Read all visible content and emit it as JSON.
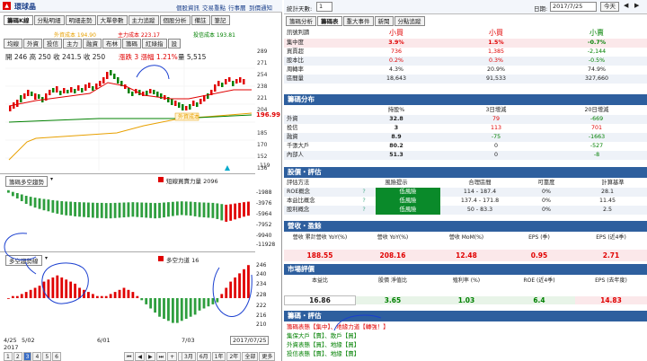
{
  "left": {
    "stock_name": "環球晶",
    "links": [
      "個股資訊",
      "交易重點",
      "行事曆",
      "到價通知"
    ],
    "top_tabs": [
      "籌碼K線",
      "分點明細",
      "明細走勢",
      "大單參數",
      "主力追蹤",
      "個股分析",
      "備註",
      "筆記"
    ],
    "sub_tabs": [
      "均線",
      "外資",
      "投信",
      "主力",
      "融資",
      "布林",
      "籌碼",
      "紅綠指",
      "設"
    ],
    "ma_legend": [
      {
        "label": "外資成本 194.90",
        "color": "#e8a000"
      },
      {
        "label": "主力成本 223.17",
        "color": "#e00000"
      },
      {
        "label": "投信成本 193.81",
        "color": "#008000"
      }
    ],
    "ohlc": "開 246  高 250  收 241.5  收 250",
    "change": "漲跌 3   漲幅 1.21%",
    "volume": "量 5,515",
    "price_axis": [
      "289",
      "271",
      "254",
      "238",
      "221",
      "204",
      "185",
      "170",
      "152",
      "136",
      "119"
    ],
    "last_price": "196.99",
    "indicator1_label": "籌碼多空趨勢",
    "indicator1_value": "短線買賣力量 2096",
    "indicator1_axis": [
      "-1988",
      "-3976",
      "-5964",
      "-7952",
      "-9940",
      "-11928"
    ],
    "indicator2_label": "多空趨勢線",
    "indicator2_value": "多空力道 16",
    "indicator2_axis": [
      "246",
      "240",
      "234",
      "228",
      "222",
      "216",
      "210"
    ],
    "x_axis": [
      "4/25",
      "5/02",
      "6/01",
      "7/03"
    ],
    "year": "2017",
    "cursor_date": "2017/07/25",
    "pages": [
      "1",
      "2",
      "3",
      "4",
      "5",
      "6"
    ],
    "periods": [
      "3月",
      "6月",
      "1年",
      "2年",
      "全部",
      "更多"
    ]
  },
  "right": {
    "stat_label": "統計天數:",
    "stat_value": "1",
    "date_label": "日期:",
    "date_value": "2017/7/25",
    "today_btn": "今天",
    "tabs": [
      "籌碼分析",
      "籌碼表",
      "重大事件",
      "新聞",
      "分點追蹤"
    ],
    "summary": {
      "headers": [
        "訊號判讀",
        "小買",
        "小買",
        "小賣"
      ],
      "rows": [
        {
          "label": "集中度",
          "values": [
            "3.9%",
            "1.5%",
            "-0.7%"
          ]
        },
        {
          "label": "買賣超",
          "values": [
            "736",
            "1,385",
            "-2,144"
          ]
        },
        {
          "label": "股本比",
          "values": [
            "0.2%",
            "0.3%",
            "-0.5%"
          ]
        },
        {
          "label": "周轉率",
          "values": [
            "4.3%",
            "20.9%",
            "74.9%"
          ]
        },
        {
          "label": "區間量",
          "values": [
            "18,643",
            "91,533",
            "327,660"
          ]
        }
      ]
    },
    "distribution": {
      "title": "籌碼分布",
      "headers": [
        "",
        "持股%",
        "3日增減",
        "20日增減"
      ],
      "rows": [
        {
          "label": "外資",
          "values": [
            "32.8",
            "79",
            "-669"
          ]
        },
        {
          "label": "投信",
          "values": [
            "3",
            "113",
            "701"
          ]
        },
        {
          "label": "融資",
          "values": [
            "8.9",
            "-75",
            "-1663"
          ]
        },
        {
          "label": "千張大戶",
          "values": [
            "80.2",
            "0",
            "-527"
          ]
        },
        {
          "label": "內部人",
          "values": [
            "51.3",
            "0",
            "-8"
          ]
        }
      ]
    },
    "valuation": {
      "title": "股價・評估",
      "headers": [
        "評估方法",
        "風險提示",
        "合理區間",
        "可靠度",
        "計算基準"
      ],
      "rows": [
        {
          "label": "ROE概念",
          "risk": "低風險",
          "range": "114 - 187.4",
          "rel": "0%",
          "base": "28.1"
        },
        {
          "label": "本益比概念",
          "risk": "低風險",
          "range": "137.4 - 171.8",
          "rel": "0%",
          "base": "11.45"
        },
        {
          "label": "股利概念",
          "risk": "低風險",
          "range": "50 - 83.3",
          "rel": "0%",
          "base": "2.5"
        }
      ]
    },
    "revenue": {
      "title": "營收・盈餘",
      "headers": [
        "營收 累計營收 YoY(%)",
        "營收 YoY(%)",
        "營收 MoM(%)",
        "EPS (季)",
        "EPS (近4季)"
      ],
      "values": [
        "188.55",
        "208.16",
        "12.48",
        "0.95",
        "2.71"
      ]
    },
    "market": {
      "title": "市場評價",
      "headers": [
        "本益比",
        "股價 淨值比",
        "殖利率 (%)",
        "ROE (近4季)",
        "EPS (去年度)"
      ],
      "values": [
        "16.86",
        "3.65",
        "1.03",
        "6.4",
        "14.83"
      ]
    },
    "judge": {
      "title": "籌碼・評估",
      "lines": [
        {
          "text": "籌碼表態【集中】、地緣力道【轉強！】",
          "color": "#e00000"
        },
        {
          "text": "集保大戶【賣】、散戶【買】",
          "color": "#008000"
        },
        {
          "text": "外資表態【買】、地緣【買】",
          "color": "#008000"
        },
        {
          "text": "投信表態【賣】、地緣【賣】",
          "color": "#008000"
        }
      ]
    }
  },
  "chart_data": [
    {
      "type": "bar",
      "title": "籌碼多空趨勢",
      "series": [
        {
          "name": "短線買賣力量",
          "values": [
            -1500,
            -2500,
            -3200,
            -4000,
            -4800,
            -5400,
            -5900,
            -6300,
            -6700,
            -7000,
            -7400,
            -7700,
            -8000,
            -8200,
            -8300,
            -8500,
            -8600,
            -8700,
            -8800,
            -8900,
            -9000,
            -9000,
            -9100,
            -9100,
            -9000,
            -8900,
            -8800,
            -8700,
            -8600,
            -8700,
            -8800,
            -8900,
            -9000,
            -9100,
            -9000,
            -8800,
            -8600,
            -8400,
            -8200,
            -8100,
            -8200,
            -8300,
            -8500,
            -8700,
            -8800,
            -8900,
            -9000,
            -9300,
            -9700,
            -10100,
            -9800,
            -9400,
            -9000,
            -8600,
            -8300
          ]
        }
      ],
      "ylim": [
        -11928,
        0
      ]
    },
    {
      "type": "bar",
      "title": "多空趨勢線",
      "series": [
        {
          "name": "多空力道",
          "values": [
            0,
            1,
            1,
            2,
            3,
            4,
            5,
            6,
            8,
            9,
            10,
            11,
            10,
            9,
            8,
            7,
            5,
            4,
            3,
            2,
            1,
            1,
            1,
            2,
            3,
            4,
            5,
            4,
            3,
            1,
            -1,
            -3,
            -5,
            -7,
            -9,
            -10,
            -11,
            -12,
            -12,
            -11,
            -10,
            -9,
            -8,
            -6,
            -5,
            -4,
            -3,
            -2,
            2,
            5,
            8,
            10,
            12,
            14,
            16
          ]
        }
      ],
      "ylim": [
        -14,
        18
      ]
    }
  ]
}
